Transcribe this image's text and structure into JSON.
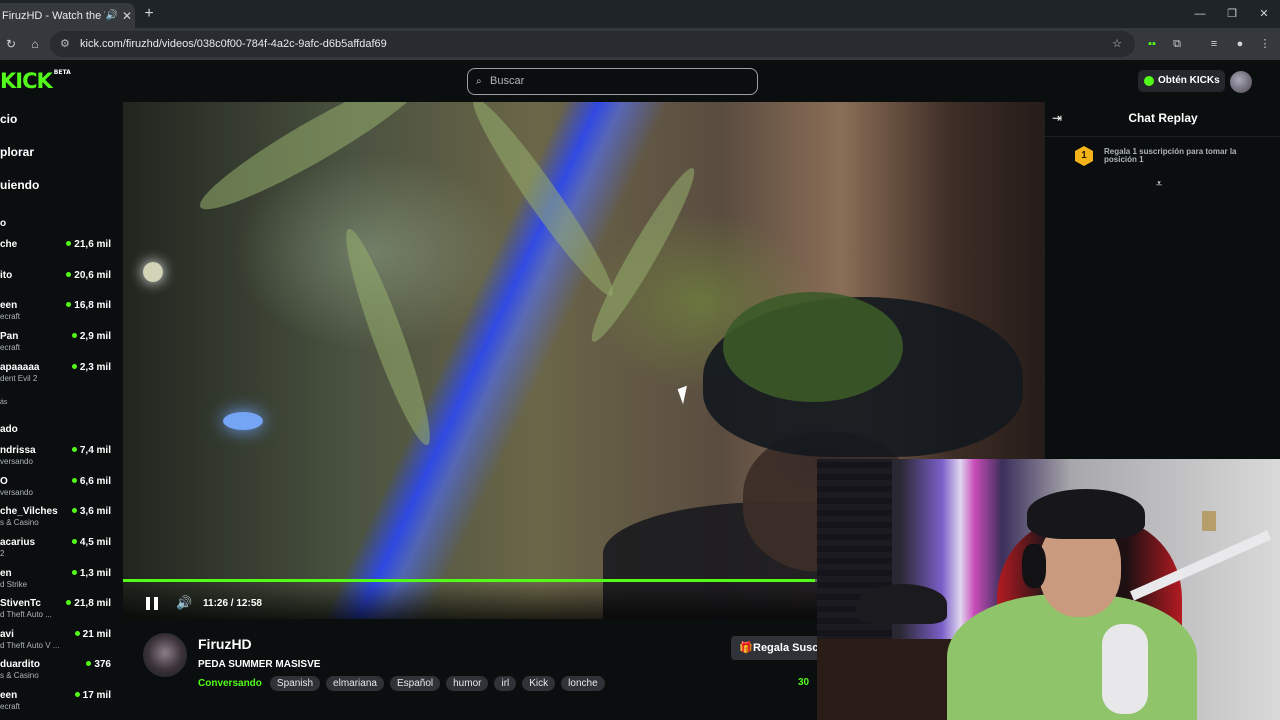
{
  "browser": {
    "tab_title": "FiruzHD - Watch the VOD o",
    "tab_speaker_icon": "speaker-icon",
    "new_tab_label": "+",
    "url": "kick.com/firuzhd/videos/038c0f00-784f-4a2c-9afc-d6b5affdaf69",
    "minimize_label": "—",
    "restore_label": "❐",
    "close_label": "✕"
  },
  "kick": {
    "logo_text": "KICK",
    "logo_badge": "BETA",
    "search_placeholder": "Buscar",
    "get_kicks_label": "Obtén KICKs",
    "accent_color": "#53fc18"
  },
  "sidebar": {
    "nav": [
      "cio",
      "plorar",
      "uiendo"
    ],
    "recommended_title": "o",
    "recommended": [
      {
        "name": "che",
        "sub": "",
        "viewers": "21,6 mil"
      },
      {
        "name": "ito",
        "sub": "",
        "viewers": "20,6 mil"
      },
      {
        "name": "een",
        "sub": "ecraft",
        "viewers": "16,8 mil"
      },
      {
        "name": "Pan",
        "sub": "ecraft",
        "viewers": "2,9 mil"
      },
      {
        "name": "apaaaaa",
        "sub": "dent Evil 2",
        "viewers": "2,3 mil"
      }
    ],
    "show_more_1": "ás",
    "following_title": "ado",
    "following": [
      {
        "name": "ndrissa",
        "sub": "versando",
        "viewers": "7,4 mil"
      },
      {
        "name": "O",
        "sub": "versando",
        "viewers": "6,6 mil"
      },
      {
        "name": "che_Vilches",
        "sub": "s & Casino",
        "viewers": "3,6 mil"
      },
      {
        "name": "acarius",
        "sub": "2",
        "viewers": "4,5 mil"
      },
      {
        "name": "en",
        "sub": "d Strike",
        "viewers": "1,3 mil"
      },
      {
        "name": "StivenTc",
        "sub": "d Theft Auto ...",
        "viewers": "21,8 mil"
      },
      {
        "name": "avi",
        "sub": "d Theft Auto V ...",
        "viewers": "21 mil"
      },
      {
        "name": "duardito",
        "sub": "s & Casino",
        "viewers": "376"
      },
      {
        "name": "een",
        "sub": "ecraft",
        "viewers": "17 mil"
      }
    ]
  },
  "player": {
    "timecode": "11:26 / 12:58",
    "progress": 0.7515,
    "state": "playing"
  },
  "channel": {
    "name": "FiruzHD",
    "vod_title": "PEDA SUMMER MASISVE",
    "category": "Conversando",
    "tags": [
      "Spanish",
      "elmariana",
      "Español",
      "humor",
      "irl",
      "Kick",
      "lonche"
    ],
    "gift_label": "Regala Suscripciones",
    "viewer_count": "30"
  },
  "chat": {
    "title": "Chat Replay",
    "goal_badge": "1",
    "goal_text": "Regala 1 suscripción para tomar la posición 1"
  }
}
